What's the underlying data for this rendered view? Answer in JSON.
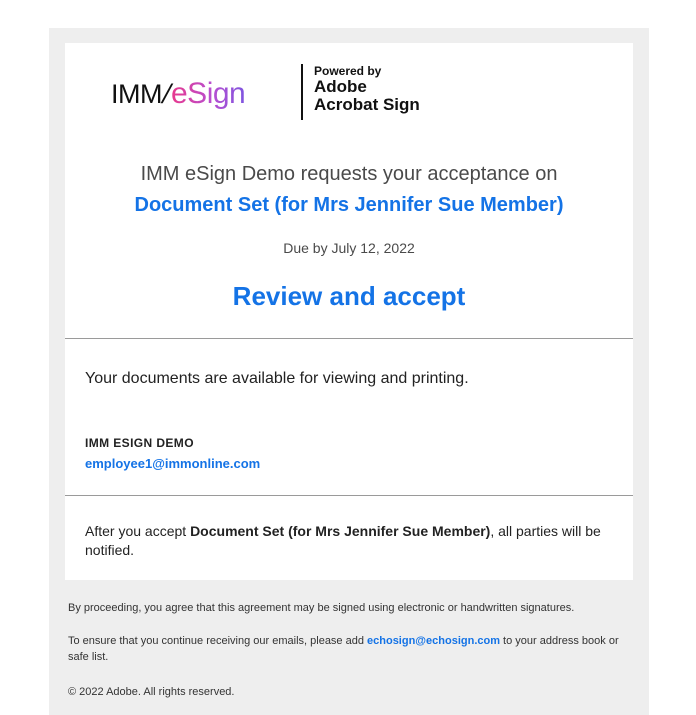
{
  "logos": {
    "imm_text": "IMM",
    "slash": "/",
    "esign_text": "eSign",
    "powered_by": "Powered by",
    "adobe": "Adobe",
    "acrobat_sign": "Acrobat Sign"
  },
  "request": {
    "text": "IMM eSign Demo requests your acceptance on",
    "document_link": "Document Set (for Mrs Jennifer Sue Member)",
    "due": "Due by July 12, 2022",
    "review_button": "Review and accept"
  },
  "body": {
    "available_text": "Your documents are available for viewing and printing.",
    "sender_name": "IMM ESIGN DEMO",
    "sender_email": "employee1@immonline.com",
    "after_prefix": "After you accept ",
    "after_document": "Document Set (for Mrs Jennifer Sue Member)",
    "after_suffix": ", all parties will be notified."
  },
  "footer": {
    "agreement": "By proceeding, you agree that this agreement may be signed using electronic or handwritten signatures.",
    "ensure_prefix": "To ensure that you continue receiving our emails, please add ",
    "ensure_email": "echosign@echosign.com",
    "ensure_suffix": " to your address book or safe list.",
    "copyright": "© 2022 Adobe. All rights reserved."
  },
  "colors": {
    "link": "#1473e6",
    "background": "#eeeeee",
    "card": "#ffffff"
  }
}
